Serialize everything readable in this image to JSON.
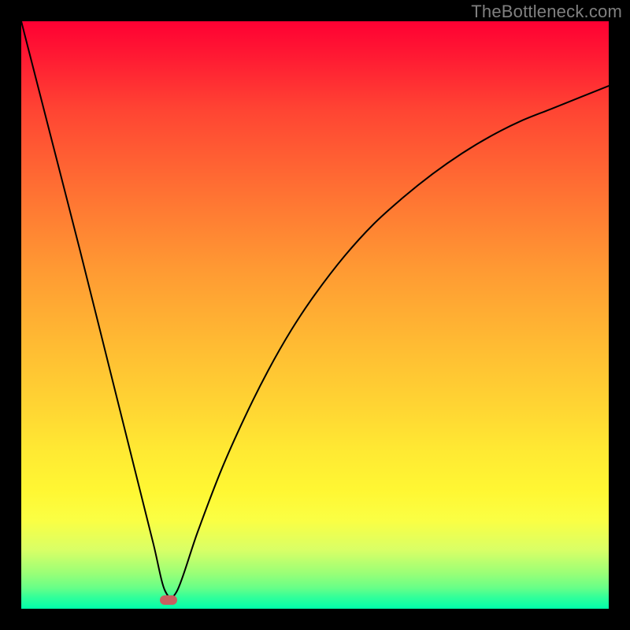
{
  "watermark": "TheBottleneck.com",
  "chart_data": {
    "type": "line",
    "title": "",
    "xlabel": "",
    "ylabel": "",
    "xlim": [
      0,
      100
    ],
    "ylim": [
      0,
      100
    ],
    "grid": false,
    "series": [
      {
        "name": "bottleneck-curve",
        "x": [
          0,
          5,
          10,
          15,
          20,
          22.5,
          24.5,
          26.5,
          30,
          34,
          38,
          42,
          46,
          50,
          55,
          60,
          65,
          70,
          75,
          80,
          85,
          90,
          95,
          100
        ],
        "values": [
          100,
          80.5,
          61,
          41,
          21,
          11,
          3,
          3,
          13,
          23.5,
          32.5,
          40.5,
          47.5,
          53.5,
          60,
          65.5,
          70,
          74,
          77.5,
          80.5,
          83,
          85,
          87,
          89
        ]
      }
    ],
    "vertex": {
      "x": 25,
      "y": 1.5
    },
    "vertex_marker": {
      "color": "#c9605f",
      "shape": "pill"
    },
    "curve_color": "#000000",
    "background": {
      "type": "vertical-gradient",
      "stops": [
        {
          "pos": 0,
          "color": "#ff0033"
        },
        {
          "pos": 50,
          "color": "#ffaa33"
        },
        {
          "pos": 80,
          "color": "#fff733"
        },
        {
          "pos": 100,
          "color": "#00ffaa"
        }
      ]
    },
    "frame_color": "#000000"
  }
}
